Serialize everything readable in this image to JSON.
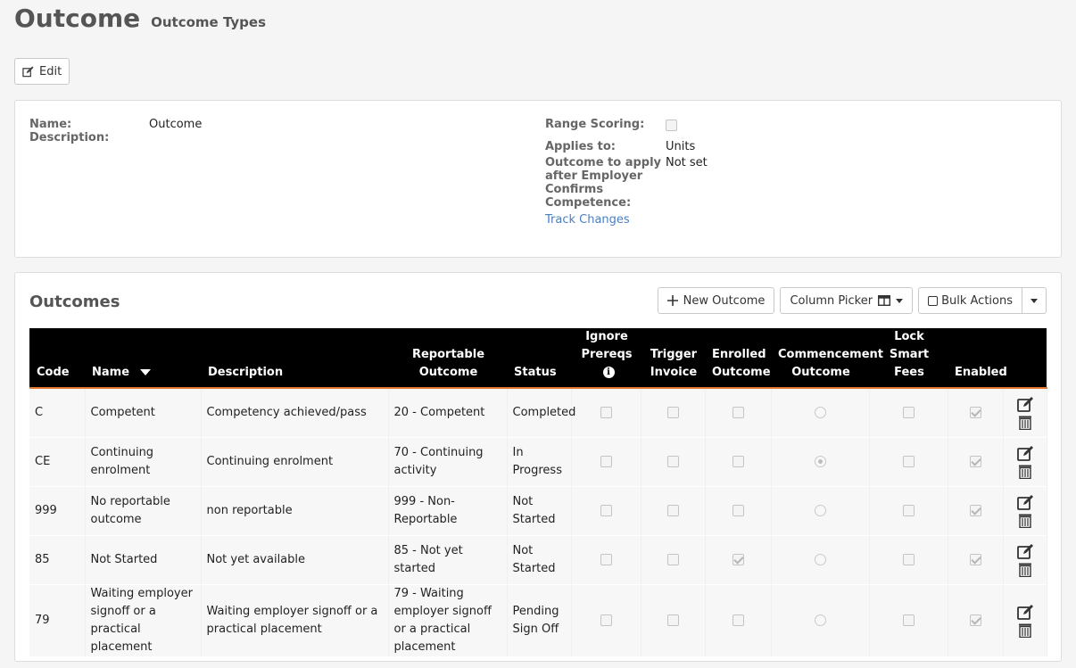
{
  "header": {
    "title": "Outcome",
    "subtitle": "Outcome Types"
  },
  "edit_button": {
    "label": "Edit",
    "icon": "pencil-square-icon"
  },
  "details": {
    "name_label": "Name:",
    "name_value": "Outcome",
    "description_label": "Description:",
    "range_scoring_label": "Range Scoring:",
    "range_scoring_checked": false,
    "applies_to_label": "Applies to:",
    "applies_to_value": "Units",
    "employer_label_1": "Outcome to apply",
    "employer_label_2": "after Employer",
    "employer_label_3": "Confirms",
    "employer_label_4": "Competence:",
    "employer_value": "Not set",
    "track_changes": "Track Changes"
  },
  "outcomes": {
    "title": "Outcomes",
    "toolbar": {
      "new_outcome": "New Outcome",
      "column_picker": "Column Picker",
      "bulk_actions": "Bulk Actions"
    },
    "columns": {
      "code": "Code",
      "name": "Name",
      "description": "Description",
      "reportable_1": "Reportable",
      "reportable_2": "Outcome",
      "status": "Status",
      "ignore_1": "Ignore",
      "ignore_2": "Prereqs",
      "trigger_1": "Trigger",
      "trigger_2": "Invoice",
      "enrolled_1": "Enrolled",
      "enrolled_2": "Outcome",
      "commence_1": "Commencement",
      "commence_2": "Outcome",
      "lock_1": "Lock Smart",
      "lock_2": "Fees",
      "enabled": "Enabled"
    },
    "rows": [
      {
        "code": "C",
        "name": "Competent",
        "description": "Competency achieved/pass",
        "reportable": "20 - Competent",
        "status": "Completed",
        "ignore": false,
        "trigger": false,
        "enrolled": false,
        "commencement": false,
        "lock": false,
        "enabled": true
      },
      {
        "code": "CE",
        "name": "Continuing enrolment",
        "description": "Continuing enrolment",
        "reportable": "70 - Continuing activity",
        "status": "In Progress",
        "ignore": false,
        "trigger": false,
        "enrolled": false,
        "commencement": true,
        "lock": false,
        "enabled": true
      },
      {
        "code": "999",
        "name": "No reportable outcome",
        "description": "non reportable",
        "reportable": "999 - Non-Reportable",
        "status": "Not Started",
        "ignore": false,
        "trigger": false,
        "enrolled": false,
        "commencement": false,
        "lock": false,
        "enabled": true
      },
      {
        "code": "85",
        "name": "Not Started",
        "description": "Not yet available",
        "reportable": "85 - Not yet started",
        "status": "Not Started",
        "ignore": false,
        "trigger": false,
        "enrolled": true,
        "commencement": false,
        "lock": false,
        "enabled": true
      },
      {
        "code": "79",
        "name": "Waiting employer signoff or a practical placement",
        "description": "Waiting employer signoff or a practical placement",
        "reportable": "79 - Waiting employer signoff or a practical placement",
        "status": "Pending Sign Off",
        "ignore": false,
        "trigger": false,
        "enrolled": false,
        "commencement": false,
        "lock": false,
        "enabled": true
      }
    ]
  }
}
